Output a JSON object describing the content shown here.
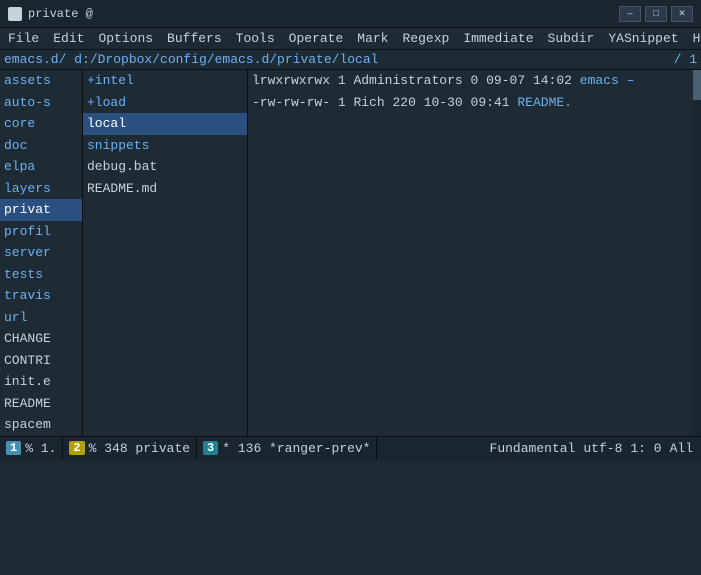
{
  "titlebar": {
    "icon": "emacs-icon",
    "title": "private @",
    "minimize": "—",
    "maximize": "□",
    "close": "✕"
  },
  "menubar": {
    "items": [
      "File",
      "Edit",
      "Options",
      "Buffers",
      "Tools",
      "Operate",
      "Mark",
      "Regexp",
      "Immediate",
      "Subdir",
      "YASnippet",
      "Help"
    ]
  },
  "pathbar": {
    "path": "emacs.d/ d:/Dropbox/config/emacs.d/private/local",
    "right": "/ 1"
  },
  "leftpanel": {
    "items": [
      {
        "label": "assets",
        "type": "folder",
        "selected": false
      },
      {
        "label": "auto-s",
        "type": "folder",
        "selected": false
      },
      {
        "label": "core",
        "type": "folder",
        "selected": false
      },
      {
        "label": "doc",
        "type": "folder",
        "selected": false
      },
      {
        "label": "elpa",
        "type": "folder",
        "selected": false
      },
      {
        "label": "layers",
        "type": "folder",
        "selected": false
      },
      {
        "label": "privat",
        "type": "folder",
        "selected": true
      },
      {
        "label": "profil",
        "type": "folder",
        "selected": false
      },
      {
        "label": "server",
        "type": "folder",
        "selected": false
      },
      {
        "label": "tests",
        "type": "folder",
        "selected": false
      },
      {
        "label": "travis",
        "type": "folder",
        "selected": false
      },
      {
        "label": "url",
        "type": "folder",
        "selected": false
      },
      {
        "label": "CHANGE",
        "type": "file",
        "selected": false
      },
      {
        "label": "CONTRI",
        "type": "file",
        "selected": false
      },
      {
        "label": "init.e",
        "type": "file",
        "selected": false
      },
      {
        "label": "README",
        "type": "file",
        "selected": false
      },
      {
        "label": "spacem",
        "type": "file",
        "selected": false
      }
    ]
  },
  "middlepanel": {
    "items": [
      {
        "label": "+intel",
        "type": "folder",
        "selected": false
      },
      {
        "label": "+load",
        "type": "folder",
        "selected": false
      },
      {
        "label": "local",
        "type": "folder",
        "selected": true
      },
      {
        "label": "snippets",
        "type": "folder",
        "selected": false
      },
      {
        "label": "debug.bat",
        "type": "file",
        "selected": false
      },
      {
        "label": "README.md",
        "type": "file",
        "selected": false
      }
    ]
  },
  "rightpanel": {
    "rows": [
      {
        "permissions": "lrwxrwxrwx",
        "links": "1",
        "owner": "Administrators",
        "size": "0",
        "date": "09-07",
        "time": "14:02",
        "name": "emacs –"
      },
      {
        "permissions": "-rw-rw-rw-",
        "links": "1",
        "owner": "Rich",
        "size": "220",
        "date": "10-30",
        "time": "09:41",
        "name": "README."
      }
    ]
  },
  "statusbar": {
    "seg1_num": "1",
    "seg1_text": "% 1.",
    "seg2_num": "2",
    "seg2_text": "% 348 private",
    "seg3_num": "3",
    "seg3_text": "* 136 *ranger-prev*",
    "right_mode": "Fundamental",
    "right_encoding": "utf-8",
    "right_pos": "1: 0",
    "right_all": "All"
  }
}
